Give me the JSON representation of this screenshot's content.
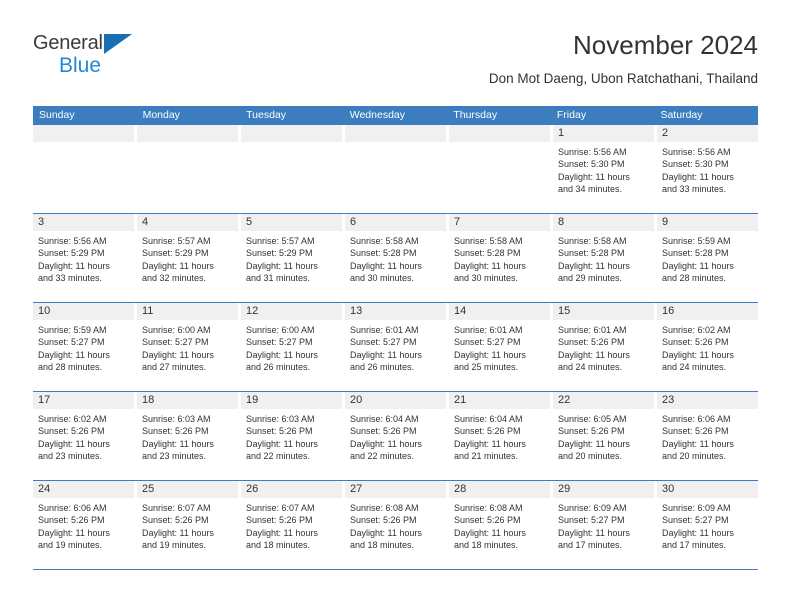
{
  "brand": {
    "name_part1": "General",
    "name_part2": "Blue",
    "accent_color": "#2288d6",
    "logo_triangle_color": "#1a6eb5"
  },
  "header": {
    "title": "November 2024",
    "subtitle": "Don Mot Daeng, Ubon Ratchathani, Thailand"
  },
  "calendar": {
    "header_bg": "#3b7dbf",
    "daynum_band_bg": "#f0f0f0",
    "weekdays": [
      "Sunday",
      "Monday",
      "Tuesday",
      "Wednesday",
      "Thursday",
      "Friday",
      "Saturday"
    ],
    "weeks": [
      [
        {
          "day": "",
          "empty": true
        },
        {
          "day": "",
          "empty": true
        },
        {
          "day": "",
          "empty": true
        },
        {
          "day": "",
          "empty": true
        },
        {
          "day": "",
          "empty": true
        },
        {
          "day": "1",
          "sunrise": "Sunrise: 5:56 AM",
          "sunset": "Sunset: 5:30 PM",
          "daylight_line1": "Daylight: 11 hours",
          "daylight_line2": "and 34 minutes."
        },
        {
          "day": "2",
          "sunrise": "Sunrise: 5:56 AM",
          "sunset": "Sunset: 5:30 PM",
          "daylight_line1": "Daylight: 11 hours",
          "daylight_line2": "and 33 minutes."
        }
      ],
      [
        {
          "day": "3",
          "sunrise": "Sunrise: 5:56 AM",
          "sunset": "Sunset: 5:29 PM",
          "daylight_line1": "Daylight: 11 hours",
          "daylight_line2": "and 33 minutes."
        },
        {
          "day": "4",
          "sunrise": "Sunrise: 5:57 AM",
          "sunset": "Sunset: 5:29 PM",
          "daylight_line1": "Daylight: 11 hours",
          "daylight_line2": "and 32 minutes."
        },
        {
          "day": "5",
          "sunrise": "Sunrise: 5:57 AM",
          "sunset": "Sunset: 5:29 PM",
          "daylight_line1": "Daylight: 11 hours",
          "daylight_line2": "and 31 minutes."
        },
        {
          "day": "6",
          "sunrise": "Sunrise: 5:58 AM",
          "sunset": "Sunset: 5:28 PM",
          "daylight_line1": "Daylight: 11 hours",
          "daylight_line2": "and 30 minutes."
        },
        {
          "day": "7",
          "sunrise": "Sunrise: 5:58 AM",
          "sunset": "Sunset: 5:28 PM",
          "daylight_line1": "Daylight: 11 hours",
          "daylight_line2": "and 30 minutes."
        },
        {
          "day": "8",
          "sunrise": "Sunrise: 5:58 AM",
          "sunset": "Sunset: 5:28 PM",
          "daylight_line1": "Daylight: 11 hours",
          "daylight_line2": "and 29 minutes."
        },
        {
          "day": "9",
          "sunrise": "Sunrise: 5:59 AM",
          "sunset": "Sunset: 5:28 PM",
          "daylight_line1": "Daylight: 11 hours",
          "daylight_line2": "and 28 minutes."
        }
      ],
      [
        {
          "day": "10",
          "sunrise": "Sunrise: 5:59 AM",
          "sunset": "Sunset: 5:27 PM",
          "daylight_line1": "Daylight: 11 hours",
          "daylight_line2": "and 28 minutes."
        },
        {
          "day": "11",
          "sunrise": "Sunrise: 6:00 AM",
          "sunset": "Sunset: 5:27 PM",
          "daylight_line1": "Daylight: 11 hours",
          "daylight_line2": "and 27 minutes."
        },
        {
          "day": "12",
          "sunrise": "Sunrise: 6:00 AM",
          "sunset": "Sunset: 5:27 PM",
          "daylight_line1": "Daylight: 11 hours",
          "daylight_line2": "and 26 minutes."
        },
        {
          "day": "13",
          "sunrise": "Sunrise: 6:01 AM",
          "sunset": "Sunset: 5:27 PM",
          "daylight_line1": "Daylight: 11 hours",
          "daylight_line2": "and 26 minutes."
        },
        {
          "day": "14",
          "sunrise": "Sunrise: 6:01 AM",
          "sunset": "Sunset: 5:27 PM",
          "daylight_line1": "Daylight: 11 hours",
          "daylight_line2": "and 25 minutes."
        },
        {
          "day": "15",
          "sunrise": "Sunrise: 6:01 AM",
          "sunset": "Sunset: 5:26 PM",
          "daylight_line1": "Daylight: 11 hours",
          "daylight_line2": "and 24 minutes."
        },
        {
          "day": "16",
          "sunrise": "Sunrise: 6:02 AM",
          "sunset": "Sunset: 5:26 PM",
          "daylight_line1": "Daylight: 11 hours",
          "daylight_line2": "and 24 minutes."
        }
      ],
      [
        {
          "day": "17",
          "sunrise": "Sunrise: 6:02 AM",
          "sunset": "Sunset: 5:26 PM",
          "daylight_line1": "Daylight: 11 hours",
          "daylight_line2": "and 23 minutes."
        },
        {
          "day": "18",
          "sunrise": "Sunrise: 6:03 AM",
          "sunset": "Sunset: 5:26 PM",
          "daylight_line1": "Daylight: 11 hours",
          "daylight_line2": "and 23 minutes."
        },
        {
          "day": "19",
          "sunrise": "Sunrise: 6:03 AM",
          "sunset": "Sunset: 5:26 PM",
          "daylight_line1": "Daylight: 11 hours",
          "daylight_line2": "and 22 minutes."
        },
        {
          "day": "20",
          "sunrise": "Sunrise: 6:04 AM",
          "sunset": "Sunset: 5:26 PM",
          "daylight_line1": "Daylight: 11 hours",
          "daylight_line2": "and 22 minutes."
        },
        {
          "day": "21",
          "sunrise": "Sunrise: 6:04 AM",
          "sunset": "Sunset: 5:26 PM",
          "daylight_line1": "Daylight: 11 hours",
          "daylight_line2": "and 21 minutes."
        },
        {
          "day": "22",
          "sunrise": "Sunrise: 6:05 AM",
          "sunset": "Sunset: 5:26 PM",
          "daylight_line1": "Daylight: 11 hours",
          "daylight_line2": "and 20 minutes."
        },
        {
          "day": "23",
          "sunrise": "Sunrise: 6:06 AM",
          "sunset": "Sunset: 5:26 PM",
          "daylight_line1": "Daylight: 11 hours",
          "daylight_line2": "and 20 minutes."
        }
      ],
      [
        {
          "day": "24",
          "sunrise": "Sunrise: 6:06 AM",
          "sunset": "Sunset: 5:26 PM",
          "daylight_line1": "Daylight: 11 hours",
          "daylight_line2": "and 19 minutes."
        },
        {
          "day": "25",
          "sunrise": "Sunrise: 6:07 AM",
          "sunset": "Sunset: 5:26 PM",
          "daylight_line1": "Daylight: 11 hours",
          "daylight_line2": "and 19 minutes."
        },
        {
          "day": "26",
          "sunrise": "Sunrise: 6:07 AM",
          "sunset": "Sunset: 5:26 PM",
          "daylight_line1": "Daylight: 11 hours",
          "daylight_line2": "and 18 minutes."
        },
        {
          "day": "27",
          "sunrise": "Sunrise: 6:08 AM",
          "sunset": "Sunset: 5:26 PM",
          "daylight_line1": "Daylight: 11 hours",
          "daylight_line2": "and 18 minutes."
        },
        {
          "day": "28",
          "sunrise": "Sunrise: 6:08 AM",
          "sunset": "Sunset: 5:26 PM",
          "daylight_line1": "Daylight: 11 hours",
          "daylight_line2": "and 18 minutes."
        },
        {
          "day": "29",
          "sunrise": "Sunrise: 6:09 AM",
          "sunset": "Sunset: 5:27 PM",
          "daylight_line1": "Daylight: 11 hours",
          "daylight_line2": "and 17 minutes."
        },
        {
          "day": "30",
          "sunrise": "Sunrise: 6:09 AM",
          "sunset": "Sunset: 5:27 PM",
          "daylight_line1": "Daylight: 11 hours",
          "daylight_line2": "and 17 minutes."
        }
      ]
    ]
  }
}
